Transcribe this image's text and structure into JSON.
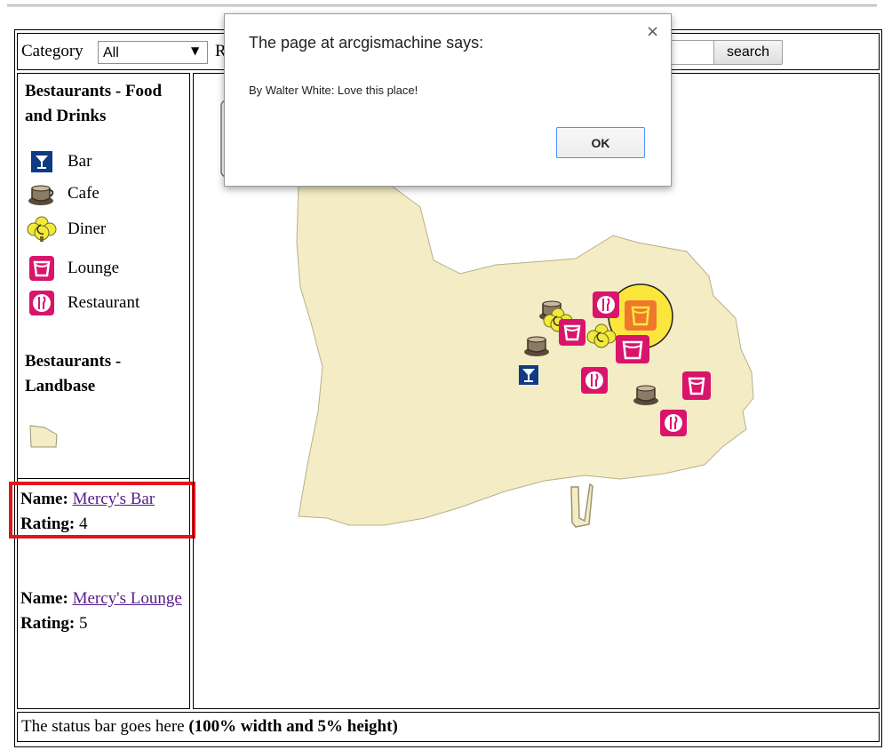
{
  "header": {
    "category_label": "Category",
    "category_value": "All",
    "r_label_partial": "R",
    "search_label": "search"
  },
  "legend": {
    "section1_title": "Bestaurants - Food and Drinks",
    "items": [
      {
        "label": "Bar",
        "icon": "bar-icon"
      },
      {
        "label": "Cafe",
        "icon": "cafe-icon"
      },
      {
        "label": "Diner",
        "icon": "diner-icon"
      },
      {
        "label": "Lounge",
        "icon": "lounge-icon"
      },
      {
        "label": "Restaurant",
        "icon": "restaurant-icon"
      }
    ],
    "section2_title": "Bestaurants - Landbase"
  },
  "results": [
    {
      "name_label": "Name:",
      "name": "Mercy's Bar",
      "rating_label": "Rating:",
      "rating": "4"
    },
    {
      "name_label": "Name:",
      "name": "Mercy's Lounge",
      "rating_label": "Rating:",
      "rating": "5"
    }
  ],
  "status": {
    "text": "The status bar goes here ",
    "bold": "(100% width and 5% height)"
  },
  "dialog": {
    "title": "The page at arcgismachine says:",
    "message": "By Walter White: Love this place!",
    "ok_label": "OK",
    "close_glyph": "×"
  },
  "colors": {
    "bar": "#0f3a84",
    "lounge": "#d9146b",
    "diner": "#f2ea3a",
    "land": "#f3ecc4",
    "highlight": "#e0161b",
    "selection": "#fbe73c"
  }
}
